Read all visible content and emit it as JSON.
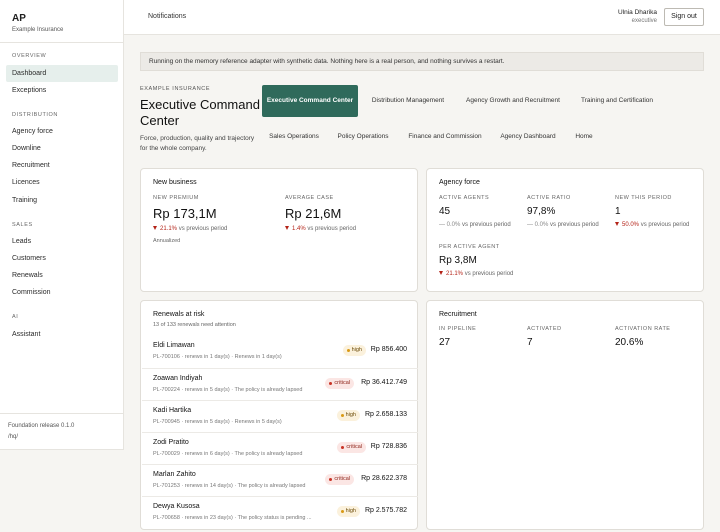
{
  "sidebar": {
    "brand": "AP",
    "brand_sub": "Example Insurance",
    "sections": [
      {
        "label": "OVERVIEW",
        "items": [
          {
            "label": "Dashboard",
            "active": true
          },
          {
            "label": "Exceptions"
          }
        ]
      },
      {
        "label": "DISTRIBUTION",
        "items": [
          {
            "label": "Agency force"
          },
          {
            "label": "Downline"
          },
          {
            "label": "Recruitment"
          },
          {
            "label": "Licences"
          },
          {
            "label": "Training"
          }
        ]
      },
      {
        "label": "SALES",
        "items": [
          {
            "label": "Leads"
          },
          {
            "label": "Customers"
          },
          {
            "label": "Renewals"
          },
          {
            "label": "Commission"
          }
        ]
      },
      {
        "label": "AI",
        "items": [
          {
            "label": "Assistant"
          }
        ]
      }
    ],
    "release": "Foundation release 0.1.0",
    "release_path": "/hq/"
  },
  "topbar": {
    "notifications": "Notifications",
    "user_name": "Ulnia Dharika",
    "user_role": "executive",
    "signout": "Sign out"
  },
  "notice": "Running on the memory reference adapter with synthetic data. Nothing here is a real person, and nothing survives a restart.",
  "header": {
    "eyebrow": "EXAMPLE INSURANCE",
    "title": "Executive Command Center",
    "description": "Force, production, quality and trajectory for the whole company."
  },
  "tabs": [
    {
      "label": "Executive Command Center",
      "active": true
    },
    {
      "label": "Distribution Management"
    },
    {
      "label": "Agency Growth and Recruitment"
    },
    {
      "label": "Training and Certification"
    },
    {
      "label": "Sales Operations"
    },
    {
      "label": "Policy Operations"
    },
    {
      "label": "Finance and Commission"
    },
    {
      "label": "Agency Dashboard"
    },
    {
      "label": "Home"
    }
  ],
  "new_business": {
    "title": "New business",
    "premium_label": "NEW PREMIUM",
    "premium_value": "Rp 173,1M",
    "premium_delta": "21.1%",
    "premium_delta_suffix": "vs previous period",
    "premium_note": "Annualized",
    "avg_label": "AVERAGE CASE",
    "avg_value": "Rp 21,6M",
    "avg_delta": "1.4%",
    "avg_delta_suffix": "vs previous period"
  },
  "agency_force": {
    "title": "Agency force",
    "active_agents_label": "ACTIVE AGENTS",
    "active_agents_value": "45",
    "active_agents_delta": "— 0.0%",
    "active_agents_delta_suffix": "vs previous period",
    "active_ratio_label": "ACTIVE RATIO",
    "active_ratio_value": "97,8%",
    "active_ratio_delta": "— 0.0%",
    "active_ratio_delta_suffix": "vs previous period",
    "new_period_label": "NEW THIS PERIOD",
    "new_period_value": "1",
    "new_period_delta": "50.0%",
    "new_period_delta_suffix": "vs previous period",
    "per_agent_label": "PER ACTIVE AGENT",
    "per_agent_value": "Rp 3,8M",
    "per_agent_delta": "21.1%",
    "per_agent_delta_suffix": "vs previous period"
  },
  "renewals": {
    "title": "Renewals at risk",
    "subtitle": "13 of 133 renewals need attention",
    "rows": [
      {
        "name": "Eldi Limawan",
        "meta": "PL-700106 · renews in 1 day(s) · Renews in 1 day(s)",
        "severity": "high",
        "amount": "Rp 856.400"
      },
      {
        "name": "Zoawan Indiyah",
        "meta": "PL-700224 · renews in 5 day(s) · The policy is already lapsed",
        "severity": "critical",
        "amount": "Rp 36.412.749"
      },
      {
        "name": "Kadi Hartika",
        "meta": "PL-700945 · renews in 5 day(s) · Renews in 5 day(s)",
        "severity": "high",
        "amount": "Rp 2.658.133"
      },
      {
        "name": "Zodi Pratito",
        "meta": "PL-700029 · renews in 6 day(s) · The policy is already lapsed",
        "severity": "critical",
        "amount": "Rp 728.836"
      },
      {
        "name": "Marlan Zahito",
        "meta": "PL-701253 · renews in 14 day(s) · The policy is already lapsed",
        "severity": "critical",
        "amount": "Rp 28.622.378"
      },
      {
        "name": "Dewya Kusosa",
        "meta": "PL-700658 · renews in 23 day(s) · The policy status is pending ...",
        "severity": "high",
        "amount": "Rp 2.575.782"
      }
    ]
  },
  "recruitment": {
    "title": "Recruitment",
    "pipeline_label": "IN PIPELINE",
    "pipeline_value": "27",
    "activated_label": "ACTIVATED",
    "activated_value": "7",
    "rate_label": "ACTIVATION RATE",
    "rate_value": "20.6%"
  },
  "colors": {
    "accent": "#2f6a5b",
    "negative": "#b42318",
    "badge_high": "#d99a16",
    "badge_critical": "#c93325"
  }
}
